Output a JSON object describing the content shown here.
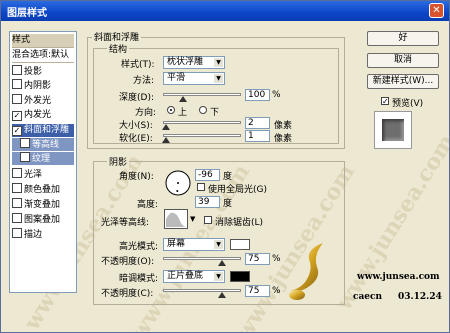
{
  "window": {
    "title": "图层样式",
    "close_symbol": "✕"
  },
  "watermark": {
    "text": "www.junsea.com"
  },
  "sidebar": {
    "header": "样式",
    "blend_options": "混合选项:默认",
    "items": [
      {
        "label": "投影",
        "checked": false
      },
      {
        "label": "内阴影",
        "checked": false
      },
      {
        "label": "外发光",
        "checked": false
      },
      {
        "label": "内发光",
        "checked": true
      },
      {
        "label": "斜面和浮雕",
        "checked": true
      },
      {
        "label": "等高线",
        "checked": false
      },
      {
        "label": "纹理",
        "checked": false
      },
      {
        "label": "光泽",
        "checked": false
      },
      {
        "label": "颜色叠加",
        "checked": false
      },
      {
        "label": "渐变叠加",
        "checked": false
      },
      {
        "label": "图案叠加",
        "checked": false
      },
      {
        "label": "描边",
        "checked": false
      }
    ]
  },
  "bevel": {
    "group_title": "斜面和浮雕",
    "struct_title": "结构",
    "style_label": "样式(T):",
    "style_value": "枕状浮雕",
    "method_label": "方法:",
    "method_value": "平滑",
    "depth_label": "深度(D):",
    "depth_value": "100",
    "depth_unit": "%",
    "depth_level": 0.25,
    "direction_label": "方向:",
    "dir_up": "上",
    "dir_down": "下",
    "size_label": "大小(S):",
    "size_value": "2",
    "size_unit": "像素",
    "soften_label": "软化(E):",
    "soften_value": "1",
    "soften_unit": "像素"
  },
  "shading": {
    "title": "阴影",
    "angle_label": "角度(N):",
    "angle_value": "-96",
    "angle_unit": "度",
    "global_light": "使用全局光(G)",
    "altitude_label": "高度:",
    "altitude_value": "39",
    "altitude_unit": "度",
    "gloss_label": "光泽等高线:",
    "anti_alias": "消除锯齿(L)",
    "highlight_label": "高光模式:",
    "highlight_mode": "屏幕",
    "highlight_color": "#ffffff",
    "opacity1_label": "不透明度(O):",
    "opacity1_value": "75",
    "opacity_unit": "%",
    "shadow_label": "暗调模式:",
    "shadow_mode": "正片叠底",
    "shadow_color": "#000000",
    "opacity2_label": "不透明度(C):",
    "opacity2_value": "75",
    "opacity_level": 0.75
  },
  "buttons": {
    "ok": "好",
    "cancel": "取消",
    "new_style": "新建样式(W)...",
    "preview": "预览(V)"
  },
  "credits": {
    "site": "www.junsea.com",
    "author": "caecn",
    "date": "03.12.24"
  }
}
